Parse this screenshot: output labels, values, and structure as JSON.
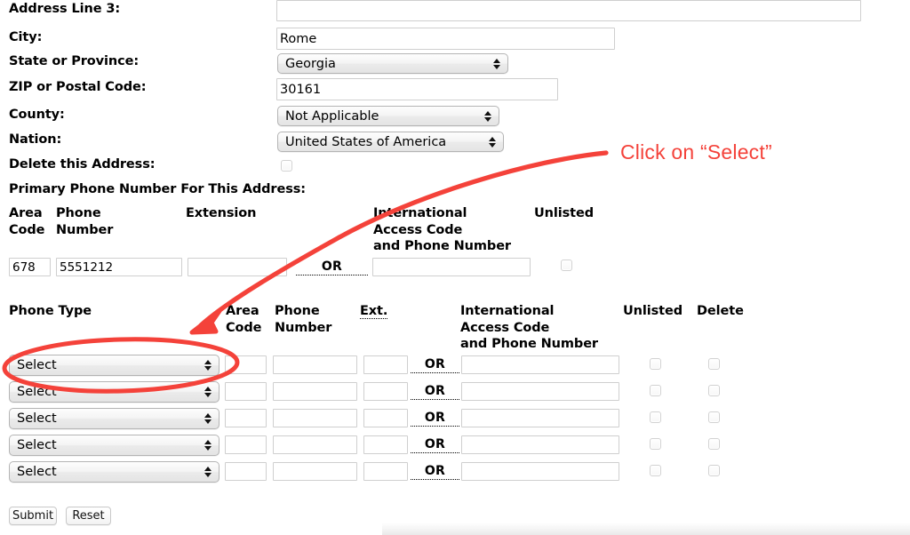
{
  "form": {
    "fields": [
      {
        "label": "Address Line 3:",
        "type": "text",
        "value": ""
      },
      {
        "label": "City:",
        "type": "text",
        "value": "Rome"
      },
      {
        "label": "State or Province:",
        "type": "select",
        "value": "Georgia"
      },
      {
        "label": "ZIP or Postal Code:",
        "type": "text",
        "value": "30161"
      },
      {
        "label": "County:",
        "type": "select",
        "value": "Not Applicable"
      },
      {
        "label": "Nation:",
        "type": "select",
        "value": "United States of America"
      },
      {
        "label": "Delete this Address:",
        "type": "checkbox",
        "value": ""
      }
    ]
  },
  "primary_phone": {
    "section_title": "Primary Phone Number For This Address:",
    "headers": {
      "area_code": "Area\nCode",
      "phone_number": "Phone\nNumber",
      "extension": "Extension",
      "international": "International\nAccess Code\nand Phone Number",
      "unlisted": "Unlisted"
    },
    "row": {
      "area_code": "678",
      "phone_number": "5551212",
      "extension": "",
      "or_label": "OR",
      "international": "",
      "unlisted_checked": false
    }
  },
  "phone_type_table": {
    "headers": {
      "phone_type": "Phone Type",
      "area_code": "Area\nCode",
      "phone_number": "Phone\nNumber",
      "ext": "Ext.",
      "international": "International\nAccess Code\nand Phone Number",
      "unlisted": "Unlisted",
      "delete": "Delete"
    },
    "or_label": "OR",
    "rows": [
      {
        "phone_type": "Select",
        "area_code": "",
        "phone_number": "",
        "ext": "",
        "international": "",
        "unlisted_checked": false,
        "delete_checked": false
      },
      {
        "phone_type": "Select",
        "area_code": "",
        "phone_number": "",
        "ext": "",
        "international": "",
        "unlisted_checked": false,
        "delete_checked": false
      },
      {
        "phone_type": "Select",
        "area_code": "",
        "phone_number": "",
        "ext": "",
        "international": "",
        "unlisted_checked": false,
        "delete_checked": false
      },
      {
        "phone_type": "Select",
        "area_code": "",
        "phone_number": "",
        "ext": "",
        "international": "",
        "unlisted_checked": false,
        "delete_checked": false
      },
      {
        "phone_type": "Select",
        "area_code": "",
        "phone_number": "",
        "ext": "",
        "international": "",
        "unlisted_checked": false,
        "delete_checked": false
      }
    ]
  },
  "actions": {
    "submit_label": "Submit",
    "reset_label": "Reset"
  },
  "annotation": {
    "text": "Click on “Select”",
    "color": "#f4423a",
    "shapes": {
      "arrow": "curved-arrow-pointing-to-first-phone-type-select",
      "ellipse": "red-ellipse-around-first-phone-type-select"
    }
  }
}
